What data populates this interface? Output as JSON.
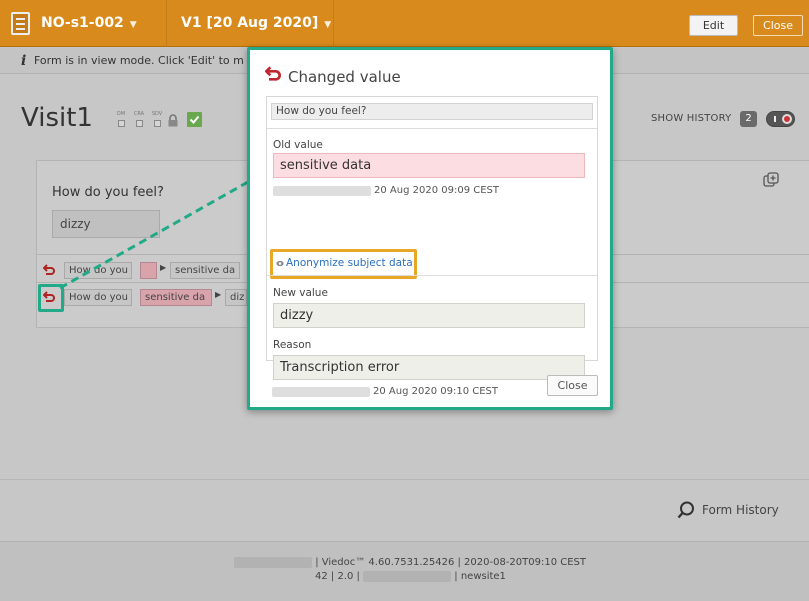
{
  "header": {
    "form_name": "NO-s1-002",
    "visit_name": "V1 [20 Aug 2020]",
    "edit_label": "Edit",
    "close_label": "Close"
  },
  "info_bar": {
    "message": "Form is in view mode. Click 'Edit' to m"
  },
  "visit": {
    "title": "Visit1",
    "flags": [
      "DM",
      "CRA",
      "SDV"
    ],
    "show_history_label": "SHOW HISTORY",
    "history_count": "2"
  },
  "form": {
    "question_label": "How do you feel?",
    "answer_value": "dizzy"
  },
  "history_rows": [
    {
      "question": "How do you",
      "old": "",
      "new": "sensitive da"
    },
    {
      "question": "How do you",
      "old": "sensitive da",
      "new": "diz"
    }
  ],
  "modal": {
    "title": "Changed value",
    "question": "How do you feel?",
    "old_label": "Old value",
    "old_value": "sensitive data",
    "old_timestamp": "20 Aug 2020 09:09 CEST",
    "anonymize_link": "Anonymize subject data",
    "new_label": "New value",
    "new_value": "dizzy",
    "reason_label": "Reason",
    "reason_value": "Transcription error",
    "new_timestamp": "20 Aug 2020 09:10 CEST",
    "close_label": "Close"
  },
  "footer": {
    "form_history_label": "Form History",
    "version_line1": "| Viedoc™ 4.60.7531.25426 | 2020-08-20T09:10 CEST",
    "version_line2_a": "42 | 2.0 |",
    "version_line2_b": "| newsite1"
  },
  "colors": {
    "header_bg": "#d98a1c",
    "highlight_green": "#22aa88",
    "highlight_orange": "#e9a728",
    "old_value_bg": "#fcdde1",
    "link_blue": "#2a6ebb"
  }
}
